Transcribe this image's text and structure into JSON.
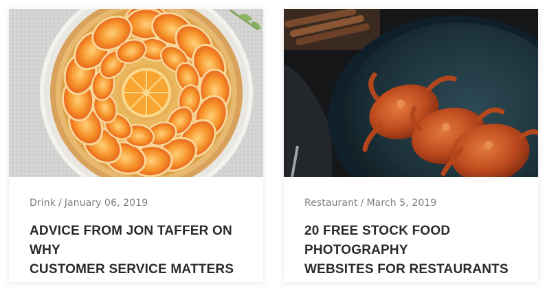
{
  "posts": [
    {
      "category": "Drink",
      "separator": "/",
      "date": "January 06, 2019",
      "title_line1": "ADVICE FROM JON TAFFER ON WHY",
      "title_line2": "CUSTOMER SERVICE MATTERS",
      "image_subject": "orange-tart-image"
    },
    {
      "category": "Restaurant",
      "separator": "/",
      "date": "March 5, 2019",
      "title_line1": "20 FREE STOCK FOOD PHOTOGRAPHY",
      "title_line2": "WEBSITES FOR RESTAURANTS",
      "image_subject": "crabs-plate-image"
    }
  ],
  "colors": {
    "meta_text": "#7d7d7d",
    "title_text": "#2a2a2a",
    "card_bg": "#ffffff"
  }
}
